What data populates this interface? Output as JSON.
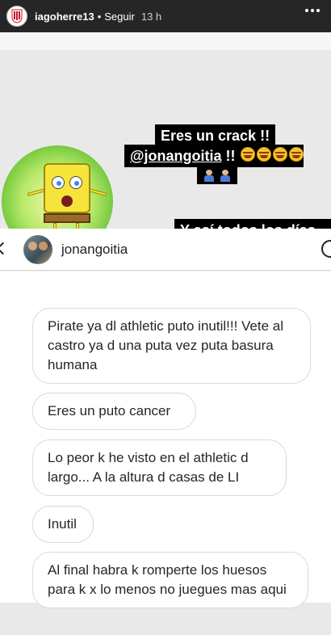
{
  "story": {
    "username": "iagoherre13",
    "dot": "•",
    "follow_label": "Seguir",
    "time": "13 h"
  },
  "captions": {
    "line1": "Eres un crack !!",
    "mention": "@jonangoitia",
    "line2_suffix": " !!",
    "line3": "Y así todos los días ."
  },
  "icons": [
    "laughing-emoji",
    "shrug-emoji"
  ],
  "dm": {
    "username": "jonangoitia",
    "messages": [
      "Pirate ya dl athletic puto inutil!!! Vete al castro ya d una puta vez puta basura humana",
      "Eres un puto cancer",
      "Lo peor k he visto en el athletic d largo... A la altura d casas de LI",
      "Inutil",
      "Al final habra k romperte los huesos para k x lo menos no juegues mas aqui"
    ]
  },
  "colors": {
    "story_bar": "#262626",
    "caption_bg": "#000000",
    "caption_text": "#ffffff",
    "bubble_border": "#d9d9d9"
  }
}
